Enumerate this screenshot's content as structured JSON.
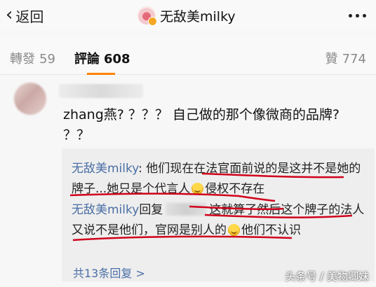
{
  "header": {
    "back_label": "返回",
    "title": "无敌美milky"
  },
  "tabs": [
    {
      "label": "轉發",
      "count": "59"
    },
    {
      "label": "評論",
      "count": "608"
    },
    {
      "label": "贊",
      "count": "774"
    }
  ],
  "comment": {
    "text": "zhang燕? ？？？ 自己做的那个像微商的品牌? ？？"
  },
  "replies": [
    {
      "user": "无敌美milky",
      "sep": ": ",
      "text_a": "他们现在在法官面前说的是这并不是她的牌子...她只是个代言人",
      "text_b": "侵权不存在"
    },
    {
      "user": "无敌美milky",
      "action": "回复",
      "text_a": "这就算了然后这个牌子的法人又说不是他们，官网是别人的",
      "text_b": "他们不认识"
    }
  ],
  "more_replies": "共13条回复 >",
  "watermark": "头条号 / 美物卿妹",
  "colors": {
    "accent": "#ff8200",
    "link": "#4a6fa5",
    "annotation": "#d0021b"
  }
}
